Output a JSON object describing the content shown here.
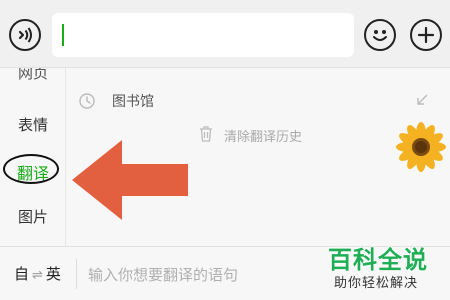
{
  "topbar": {
    "voice_icon": "voice-icon",
    "emoji_icon": "emoji-icon",
    "plus_icon": "plus-icon",
    "input_value": ""
  },
  "sidebar": {
    "items": [
      {
        "label": "网页"
      },
      {
        "label": "表情"
      },
      {
        "label": "翻译",
        "selected": true
      },
      {
        "label": "图片"
      }
    ]
  },
  "panel": {
    "history_item": "图书馆",
    "clear_label": "清除翻译历史"
  },
  "bottom": {
    "lang_from": "自",
    "swap_symbol": "⇌",
    "lang_to": "英",
    "placeholder": "输入你想要翻译的语句"
  },
  "watermark": {
    "title": "百科全说",
    "subtitle": "助你轻松解决"
  },
  "colors": {
    "accent": "#1aad19",
    "arrow": "#e2603f",
    "watermark": "#1fae55"
  }
}
